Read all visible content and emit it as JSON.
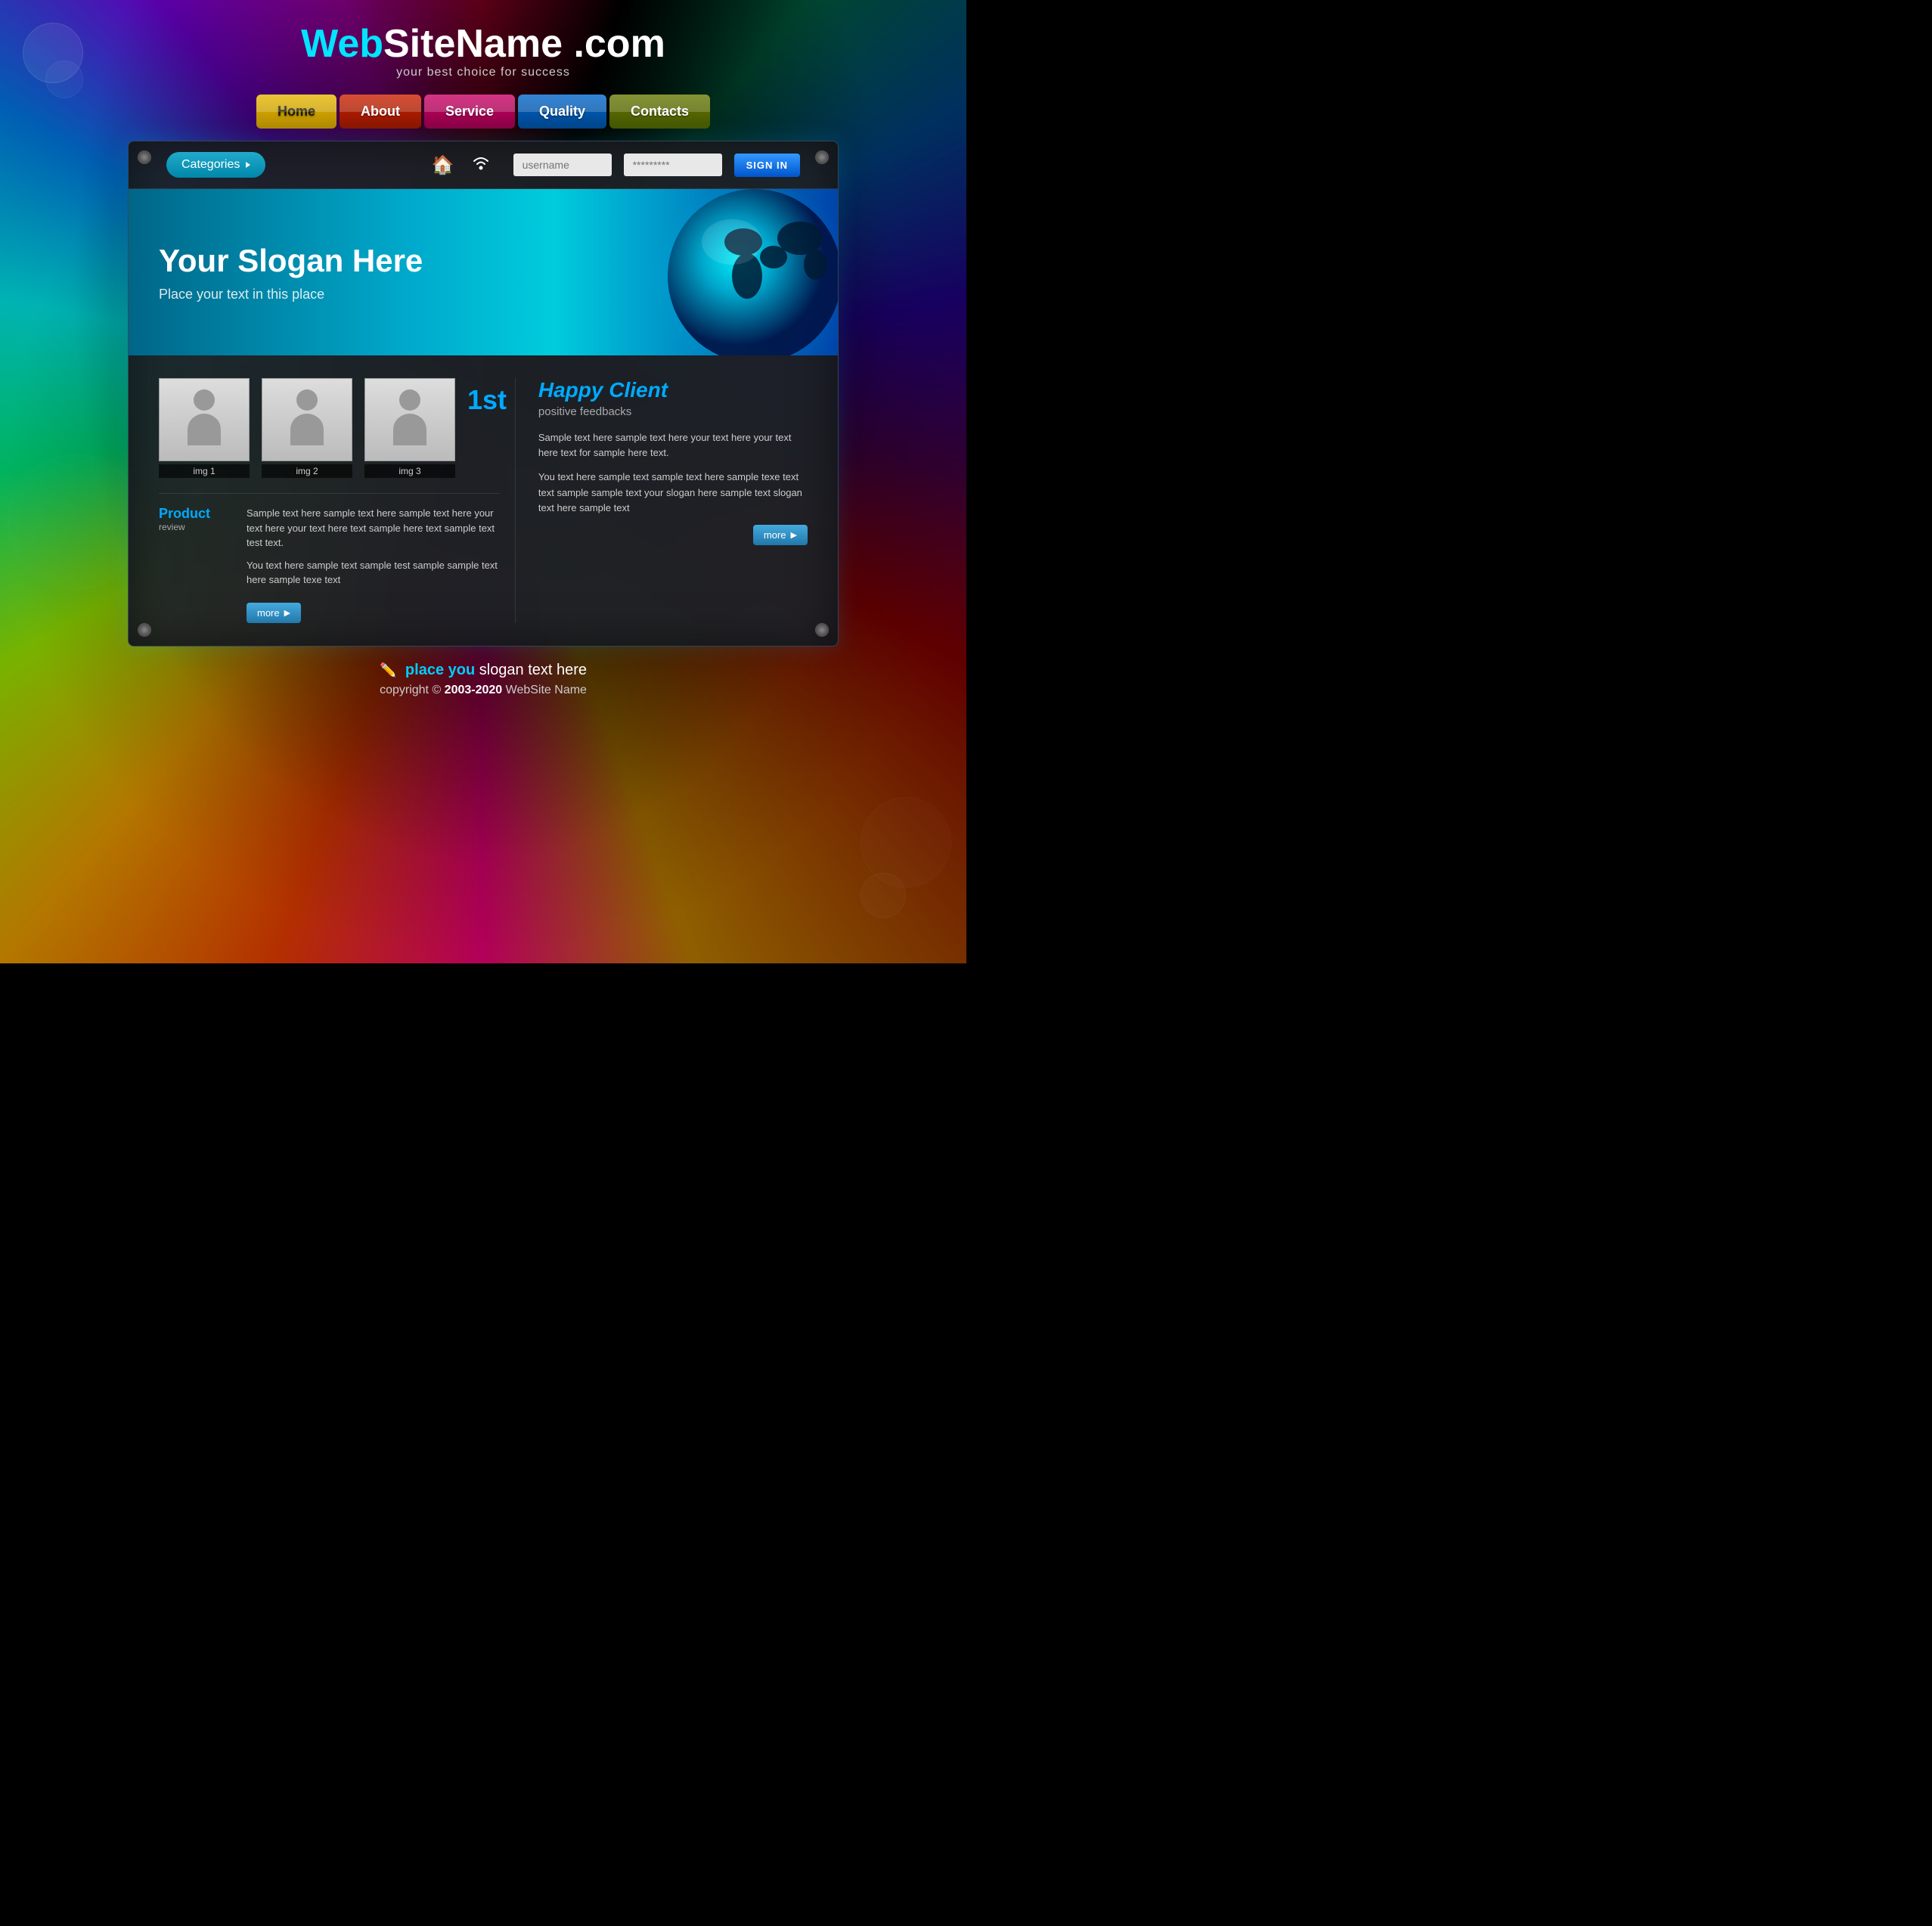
{
  "site": {
    "title_web": "Web",
    "title_rest": "SiteName .com",
    "tagline": "your best choice for success"
  },
  "nav": {
    "items": [
      {
        "label": "Home",
        "class": "nav-home"
      },
      {
        "label": "About",
        "class": "nav-about"
      },
      {
        "label": "Service",
        "class": "nav-service"
      },
      {
        "label": "Quality",
        "class": "nav-quality"
      },
      {
        "label": "Contacts",
        "class": "nav-contacts"
      }
    ]
  },
  "topbar": {
    "categories_label": "Categories",
    "username_placeholder": "username",
    "password_placeholder": "*********",
    "signin_label": "SIGN IN"
  },
  "hero": {
    "heading": "Your Slogan Here",
    "subtext": "Place your text in this place"
  },
  "images": [
    {
      "label": "img 1"
    },
    {
      "label": "img 2"
    },
    {
      "label": "img 3"
    }
  ],
  "rank": "1st",
  "product": {
    "title": "Product",
    "subtitle": "review",
    "text1": "Sample text here sample text here sample text here your text here your text here text sample here text sample text test text.",
    "text2": "You text here sample text sample test sample sample text here sample texe text",
    "more_label": "more"
  },
  "happy_client": {
    "title": "Happy Client",
    "subtitle": "positive feedbacks",
    "text1": "Sample text here sample text here your text here your text here text for sample here text.",
    "text2": "You text here sample text sample text here sample texe text text sample sample text your slogan here sample text slogan text here sample text",
    "more_label": "more"
  },
  "footer": {
    "highlight": "place you",
    "slogan_rest": " slogan text here",
    "copyright": "copyright © ",
    "year_bold": "2003-2020",
    "brand": " WebSite Name"
  }
}
